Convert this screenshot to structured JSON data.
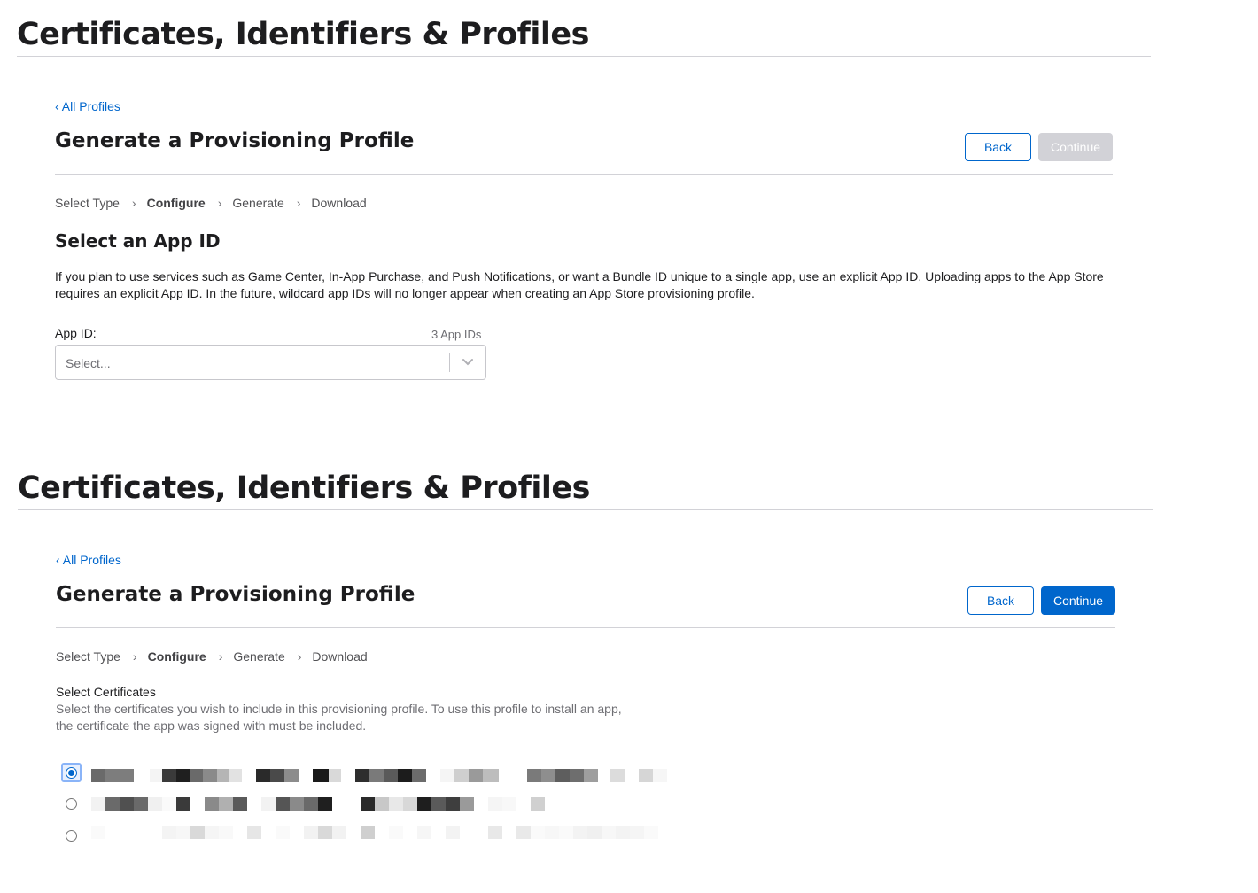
{
  "header_title": "Certificates, Identifiers & Profiles",
  "panel1": {
    "back_link": "‹ All Profiles",
    "title": "Generate a Provisioning Profile",
    "back_button": "Back",
    "continue_button": "Continue",
    "steps": [
      "Select Type",
      "Configure",
      "Generate",
      "Download"
    ],
    "section_title": "Select an App ID",
    "description": "If you plan to use services such as Game Center, In-App Purchase, and Push Notifications, or want a Bundle ID unique to a single app, use an explicit App ID. Uploading apps to the App Store requires an explicit App ID. In the future, wildcard app IDs will no longer appear when creating an App Store provisioning profile.",
    "app_id_label": "App ID:",
    "app_id_count": "3 App IDs",
    "app_id_placeholder": "Select..."
  },
  "panel2": {
    "back_link": "‹ All Profiles",
    "title": "Generate a Provisioning Profile",
    "back_button": "Back",
    "continue_button": "Continue",
    "steps": [
      "Select Type",
      "Configure",
      "Generate",
      "Download"
    ],
    "section_title": "Select Certificates",
    "description_line1": "Select the certificates you wish to include in this provisioning profile. To use this profile to install an app,",
    "description_line2": "the certificate the app was signed with must be included.",
    "certificates": [
      {
        "selected": true
      },
      {
        "selected": false
      },
      {
        "selected": false
      }
    ]
  },
  "colors": {
    "accent": "#0066cc",
    "disabled": "#d2d2d7",
    "divider": "#d2d2d7"
  }
}
